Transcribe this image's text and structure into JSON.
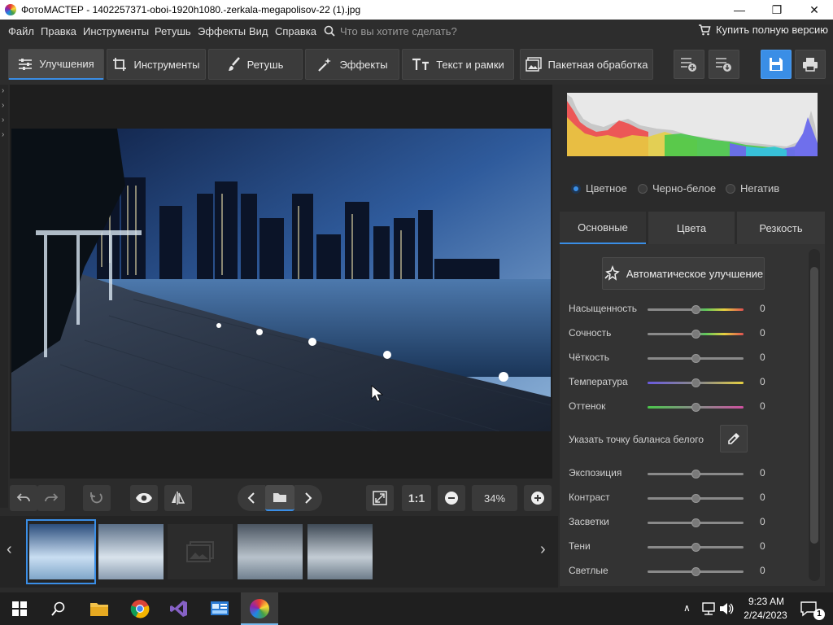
{
  "titlebar": {
    "title": "ФотоМАСТЕР - 1402257371-oboi-1920h1080.-zerkala-megapolisov-22 (1).jpg",
    "minimize": "—",
    "maximize": "❐",
    "close": "✕"
  },
  "menu": {
    "items": [
      "Файл",
      "Правка",
      "Инструменты",
      "Ретушь",
      "Эффекты",
      "Вид",
      "Справка"
    ],
    "search_placeholder": "Что вы хотите сделать?",
    "buy_label": "Купить полную версию"
  },
  "toolbar": {
    "tabs": [
      "Улучшения",
      "Инструменты",
      "Ретушь",
      "Эффекты",
      "Текст и рамки"
    ],
    "batch_label": "Пакетная обработка",
    "active_tab": 0
  },
  "controls": {
    "one_to_one": "1:1",
    "zoom": "34%"
  },
  "color_modes": {
    "options": [
      "Цветное",
      "Черно-белое",
      "Негатив"
    ],
    "selected": 0
  },
  "panel_tabs": {
    "tabs": [
      "Основные",
      "Цвета",
      "Резкость"
    ],
    "active": 0
  },
  "auto_enhance_label": "Автоматическое улучшение",
  "sliders_top": [
    {
      "label": "Насыщенность",
      "value": "0"
    },
    {
      "label": "Сочность",
      "value": "0"
    },
    {
      "label": "Чёткость",
      "value": "0"
    },
    {
      "label": "Температура",
      "value": "0"
    },
    {
      "label": "Оттенок",
      "value": "0"
    }
  ],
  "white_balance_label": "Указать точку баланса белого",
  "sliders_bottom": [
    {
      "label": "Экспозиция",
      "value": "0"
    },
    {
      "label": "Контраст",
      "value": "0"
    },
    {
      "label": "Засветки",
      "value": "0"
    },
    {
      "label": "Тени",
      "value": "0"
    },
    {
      "label": "Светлые",
      "value": "0"
    }
  ],
  "taskbar": {
    "time": "9:23 AM",
    "date": "2/24/2023",
    "notification_count": "1"
  },
  "colors": {
    "accent": "#3a8ee6",
    "save_button": "#3a8ee6"
  }
}
